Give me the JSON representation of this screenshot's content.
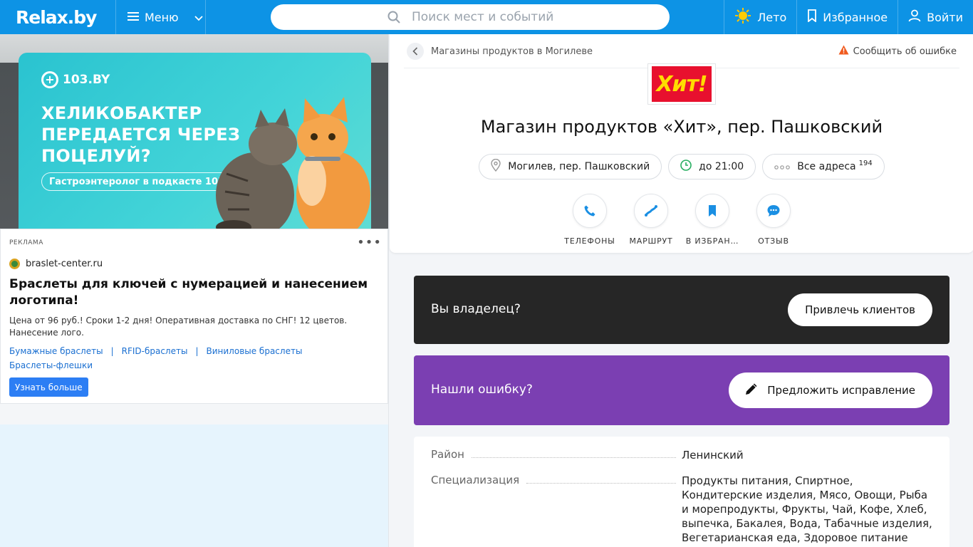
{
  "header": {
    "logo": "Relax.by",
    "menu_label": "Меню",
    "search_placeholder": "Поиск мест и событий",
    "season_label": "Лето",
    "favorites_label": "Избранное",
    "login_label": "Войти"
  },
  "banner": {
    "brand": "103.BY",
    "headline": "ХЕЛИКОБАКТЕР ПЕРЕДАЕТСЯ ЧЕРЕЗ ПОЦЕЛУЙ?",
    "pill": "Гастроэнтеролог в подкасте 103.by"
  },
  "ad": {
    "label": "РЕКЛАМА",
    "domain": "braslet-center.ru",
    "title": "Браслеты для ключей с нумерацией и нанесением логотипа!",
    "text": "Цена от 96 руб.! Сроки 1-2 дня! Оперативная доставка по СНГ! 12 цветов. Нанесение лого.",
    "links": [
      "Бумажные браслеты",
      "RFID-браслеты",
      "Виниловые браслеты",
      "Браслеты-флешки"
    ],
    "button": "Узнать больше"
  },
  "place": {
    "breadcrumb": "Магазины продуктов в Могилеве",
    "report": "Сообщить об ошибке",
    "brand_logo_text": "Хит!",
    "title": "Магазин продуктов «Хит», пер. Пашковский",
    "address": "Могилев, пер. Пашковский",
    "hours": "до 21:00",
    "all_addresses": "Все адреса",
    "all_addresses_count": "194",
    "actions": [
      {
        "label": "ТЕЛЕФОНЫ",
        "icon": "phone-icon"
      },
      {
        "label": "МАРШРУТ",
        "icon": "route-icon"
      },
      {
        "label": "В ИЗБРАН…",
        "icon": "bookmark-icon"
      },
      {
        "label": "ОТЗЫВ",
        "icon": "comment-icon"
      }
    ]
  },
  "owner": {
    "text": "Вы владелец?",
    "button": "Привлечь клиентов"
  },
  "error_block": {
    "text": "Нашли ошибку?",
    "button": "Предложить исправление"
  },
  "info": {
    "district_key": "Район",
    "district_val": "Ленинский",
    "spec_key": "Специализация",
    "spec_val": "Продукты питания, Спиртное, Кондитерские изделия, Мясо, Овощи, Рыба и морепродукты, Фрукты, Чай, Кофе, Хлеб, выпечка, Бакалея, Вода, Табачные изделия, Вегетарианская еда, Здоровое питание"
  },
  "colors": {
    "header_bg": "#0d93e5",
    "owner_bg": "#262626",
    "error_bg": "#7b3fb2",
    "brand_red": "#e8102e",
    "brand_yellow": "#ffdd00"
  }
}
